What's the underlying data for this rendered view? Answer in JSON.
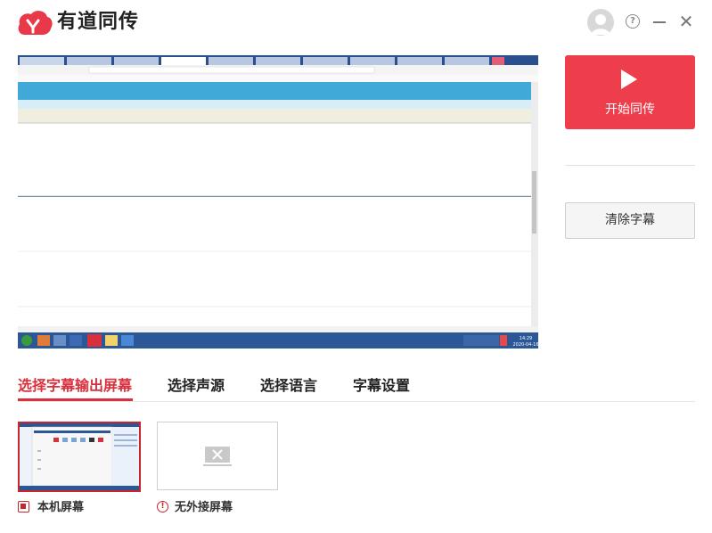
{
  "app": {
    "title": "有道同传"
  },
  "window": {
    "help_symbol": "?",
    "close_symbol": "✕"
  },
  "actions": {
    "start_label": "开始同传",
    "clear_label": "清除字幕"
  },
  "tabs": [
    {
      "label": "选择字幕输出屏幕",
      "active": true
    },
    {
      "label": "选择声源",
      "active": false
    },
    {
      "label": "选择语言",
      "active": false
    },
    {
      "label": "字幕设置",
      "active": false
    }
  ],
  "screens": [
    {
      "label": "本机屏幕",
      "selected": true,
      "icon": "checkbox-checked-icon"
    },
    {
      "label": "无外接屏幕",
      "selected": false,
      "icon": "warning-icon"
    }
  ],
  "preview": {
    "clock_time": "14:29",
    "clock_date": "2020-04-16"
  },
  "colors": {
    "accent": "#ee3e4c",
    "tab_active": "#d9303e",
    "taskbar": "#2b5797",
    "preview_banner": "#41a9d8"
  }
}
